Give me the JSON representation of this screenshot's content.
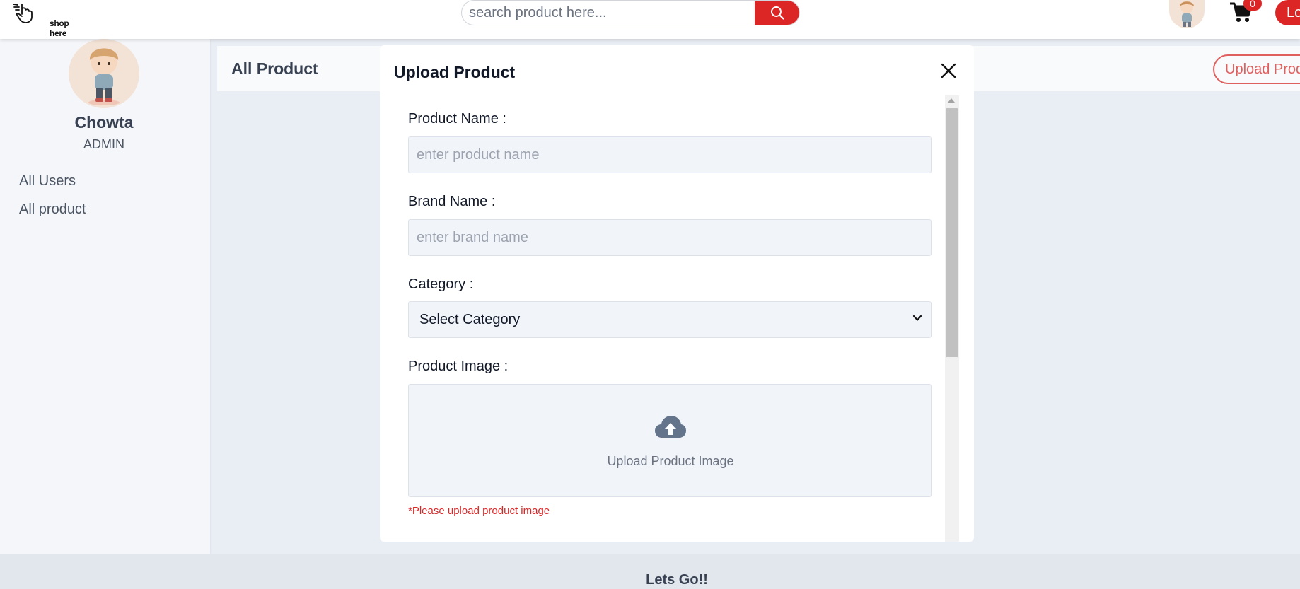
{
  "header": {
    "logo_text": "shop here",
    "search_placeholder": "search product here...",
    "cart_count": "0",
    "login_label": "Login"
  },
  "sidebar": {
    "user_name": "Chowta",
    "user_role": "ADMIN",
    "items": [
      {
        "label": "All Users"
      },
      {
        "label": "All product"
      }
    ]
  },
  "main": {
    "title": "All Product",
    "upload_button_label": "Upload Product"
  },
  "modal": {
    "title": "Upload Product",
    "fields": {
      "product_name_label": "Product Name :",
      "product_name_placeholder": "enter product name",
      "brand_name_label": "Brand Name :",
      "brand_name_placeholder": "enter brand name",
      "category_label": "Category :",
      "category_selected": "Select Category",
      "product_image_label": "Product Image :",
      "upload_image_text": "Upload Product Image",
      "upload_error": "*Please upload product image"
    }
  },
  "footer": {
    "text": "Lets Go!!"
  },
  "colors": {
    "accent": "#dc2626",
    "accent_outline": "#e06060",
    "background": "#e9edf4"
  }
}
